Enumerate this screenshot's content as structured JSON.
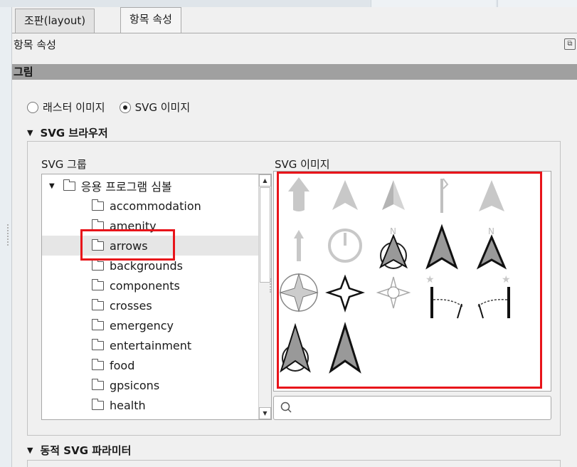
{
  "tabs": [
    {
      "label": "조판(layout)",
      "active": false
    },
    {
      "label": "항목 속성",
      "active": true
    }
  ],
  "dock_title": "항목 속성",
  "group_title": "그림",
  "source": {
    "raster_label": "래스터 이미지",
    "svg_label": "SVG 이미지",
    "selected": "SVG 이미지"
  },
  "svg_browser": {
    "title": "SVG 브라우저",
    "group_label": "SVG 그룹",
    "image_label": "SVG 이미지",
    "tree": {
      "root": "응용 프로그램 심볼",
      "items": [
        "accommodation",
        "amenity",
        "arrows",
        "backgrounds",
        "components",
        "crosses",
        "emergency",
        "entertainment",
        "food",
        "gpsicons",
        "health"
      ],
      "selected": "arrows"
    },
    "search_placeholder": "",
    "icons": [
      "arrow-up-bold-icon",
      "north-arrow-icon",
      "north-arrow-half-icon",
      "arrow-thin-flag-icon",
      "north-arrow-icon",
      "arrow-up-thin-icon",
      "power-circle-icon",
      "north-arrow-circle-icon",
      "north-arrow-bold-icon",
      "north-arrow-bold-n-icon",
      "compass-rose-circle-icon",
      "compass-star-icon",
      "compass-star-light-icon",
      "dimension-arc-left-icon",
      "dimension-arc-right-icon",
      "north-arrow-circle-icon",
      "north-arrow-bold-icon"
    ]
  },
  "dynamic_params_title": "동적 SVG 파라미터",
  "colors": {
    "highlight": "#e8141a",
    "header_bar": "#a0a0a0"
  }
}
